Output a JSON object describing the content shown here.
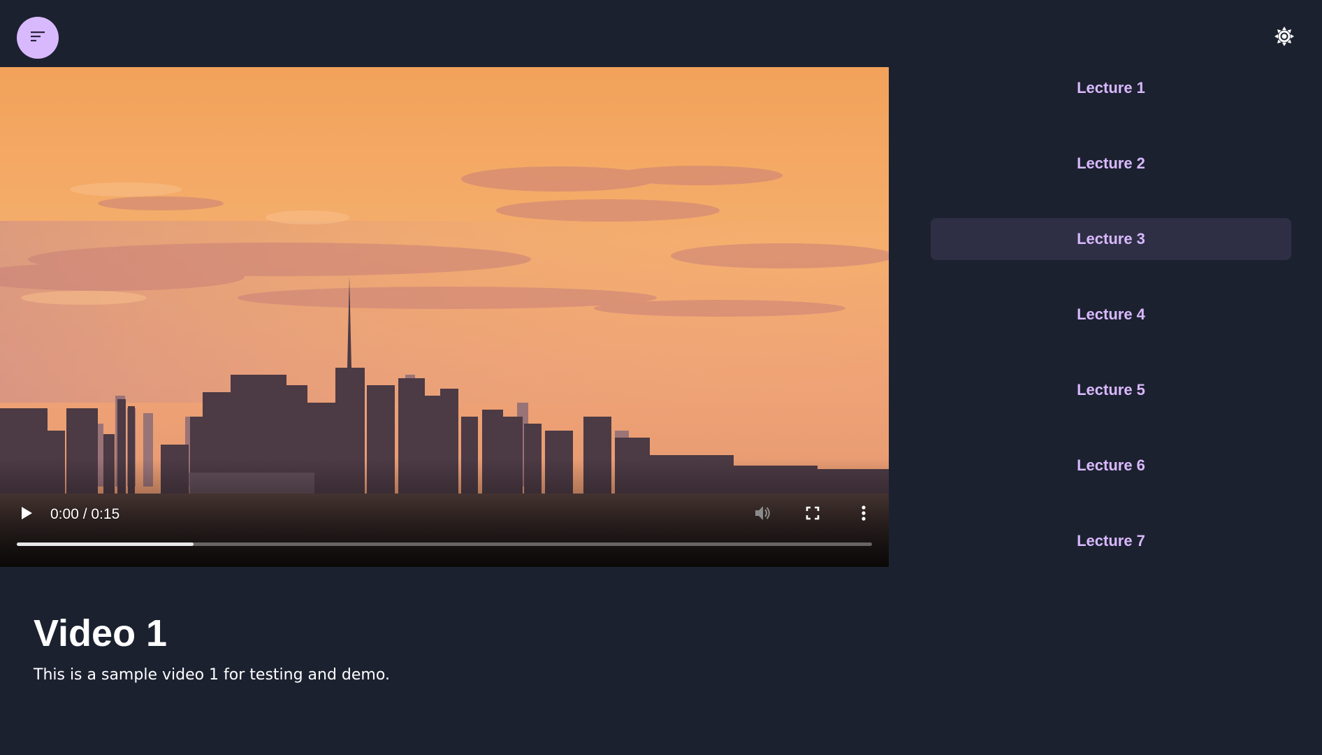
{
  "app": {
    "colors": {
      "background": "#1c2130",
      "accent": "#d8b9fd",
      "active_item_bg": "#2e2f45",
      "text": "#ffffff"
    }
  },
  "header": {
    "menu_icon": "sort-lines-icon",
    "theme_icon": "sun-icon"
  },
  "player": {
    "time_display": "0:00 / 0:15",
    "progress_buffered_fraction": 0.207,
    "icons": {
      "play": "play-icon",
      "volume": "volume-icon",
      "fullscreen": "fullscreen-icon",
      "more": "more-vert-icon"
    }
  },
  "sidebar": {
    "active_index": 2,
    "items": [
      {
        "label": "Lecture 1"
      },
      {
        "label": "Lecture 2"
      },
      {
        "label": "Lecture 3"
      },
      {
        "label": "Lecture 4"
      },
      {
        "label": "Lecture 5"
      },
      {
        "label": "Lecture 6"
      },
      {
        "label": "Lecture 7"
      }
    ]
  },
  "video": {
    "title": "Video 1",
    "description": "This is a sample video 1 for testing and demo."
  }
}
